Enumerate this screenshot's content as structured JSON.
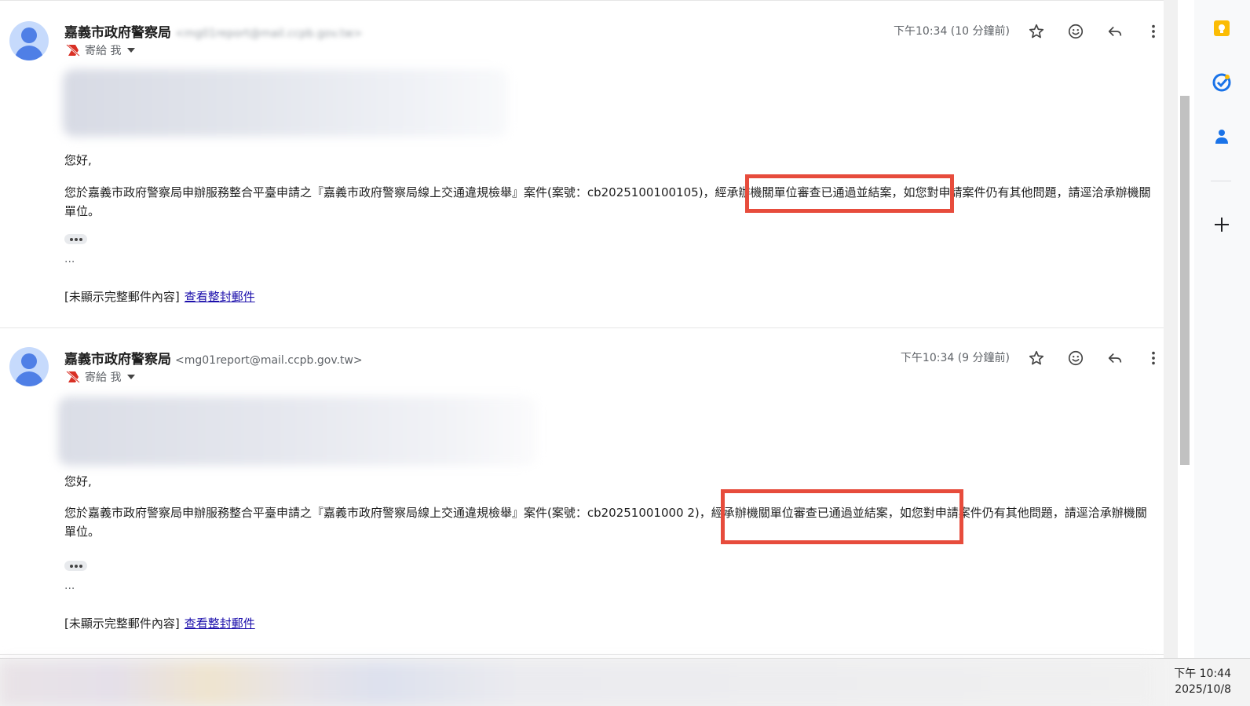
{
  "messages": [
    {
      "sender_name": "嘉義市政府警察局",
      "sender_email": "<mg01report@mail.ccpb.gov.tw>",
      "recipient_label": "寄給 我",
      "timestamp": "下午10:34 (10 分鐘前)",
      "greeting": "您好,",
      "body": "您於嘉義市政府警察局申辦服務整合平臺申請之『嘉義市政府警察局線上交通違規檢舉』案件(案號：cb2025100100105)，經承辦機關單位審查已通過並結案，如您對申請案件仍有其他問題，請逕洽承辦機關單位。",
      "ellipsis": "...",
      "trimmed_notice": "[未顯示完整郵件內容]",
      "view_full_link": "查看整封郵件"
    },
    {
      "sender_name": "嘉義市政府警察局",
      "sender_email": "<mg01report@mail.ccpb.gov.tw>",
      "recipient_label": "寄給 我",
      "timestamp": "下午10:34 (9 分鐘前)",
      "greeting": "您好,",
      "body": "您於嘉義市政府警察局申辦服務整合平臺申請之『嘉義市政府警察局線上交通違規檢舉』案件(案號：cb20251001000 2)，經承辦機關單位審查已通過並結案，如您對申請案件仍有其他問題，請逕洽承辦機關單位。",
      "ellipsis": "...",
      "trimmed_notice": "[未顯示完整郵件內容]",
      "view_full_link": "查看整封郵件"
    }
  ],
  "action_icons": [
    "star-icon",
    "emoji-reaction-icon",
    "reply-icon",
    "more-vert-icon"
  ],
  "side_panel": {
    "icons": [
      "keep-icon",
      "tasks-icon",
      "contacts-icon",
      "add-icon"
    ]
  },
  "taskbar": {
    "time": "下午 10:44",
    "date": "2025/10/8"
  },
  "colors": {
    "highlight": "#e74c3c",
    "link": "#1a0dab",
    "avatar_bg": "#c6dafc",
    "avatar_fg": "#4f7fe6",
    "keep_yellow": "#fbbc04",
    "tasks_blue": "#1a73e8",
    "important_red": "#d93025"
  }
}
